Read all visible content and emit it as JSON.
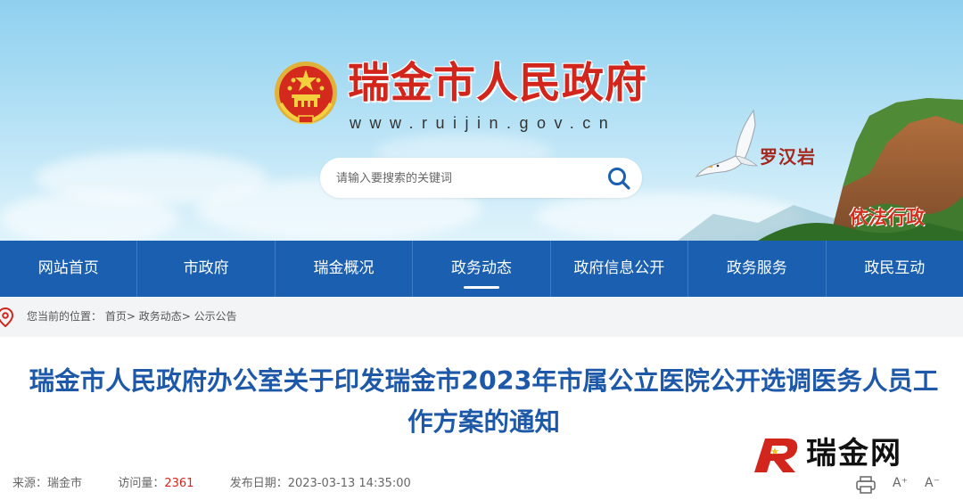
{
  "header": {
    "site_title": "瑞金市人民政府",
    "site_url": "www.ruijin.gov.cn",
    "scenic_label": "罗汉岩",
    "slogan": "依法行政",
    "search": {
      "placeholder": "请输入要搜索的关键词",
      "icon": "search-icon"
    }
  },
  "nav": {
    "items": [
      {
        "label": "网站首页"
      },
      {
        "label": "市政府"
      },
      {
        "label": "瑞金概况"
      },
      {
        "label": "政务动态",
        "active": true
      },
      {
        "label": "政府信息公开"
      },
      {
        "label": "政务服务"
      },
      {
        "label": "政民互动"
      }
    ]
  },
  "breadcrumb": {
    "prefix": "您当前的位置：",
    "items": [
      {
        "label": "首页"
      },
      {
        "label": "政务动态"
      },
      {
        "label": "公示公告"
      }
    ],
    "separator": ">",
    "icon": "location-pin-icon"
  },
  "article": {
    "title": "瑞金市人民政府办公室关于印发瑞金市2023年市属公立医院公开选调医务人员工作方案的通知",
    "source_label": "来源：",
    "source": "瑞金市",
    "visits_label": "访问量：",
    "visits": "2361",
    "date_label": "发布日期：",
    "date": "2023-03-13 14:35:00",
    "tools": {
      "print_icon": "print-icon",
      "font_up": "A⁺",
      "font_down": "A⁻"
    }
  },
  "watermark": {
    "text": "瑞金网"
  },
  "colors": {
    "nav_bg": "#1a5fb0",
    "title_red": "#d2261c",
    "article_title": "#1d59a8",
    "visits_red": "#d2261c"
  }
}
